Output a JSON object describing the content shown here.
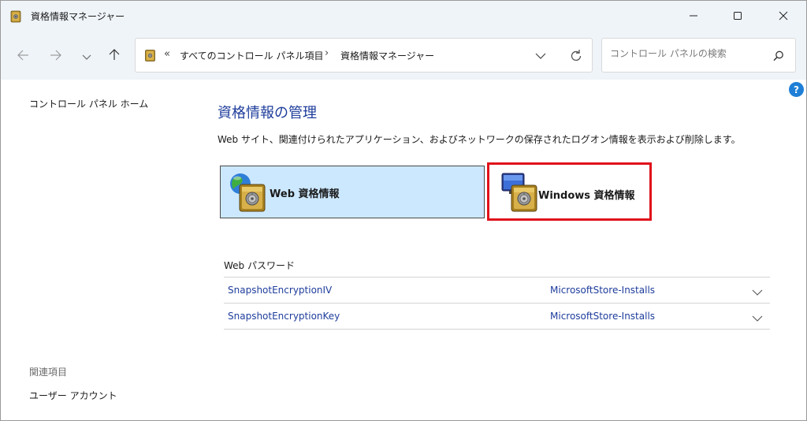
{
  "window": {
    "title": "資格情報マネージャー"
  },
  "titlebar": {
    "icons": [
      "minimize-icon",
      "maximize-icon",
      "close-icon"
    ]
  },
  "nav": {
    "icons": [
      "back-arrow-icon",
      "forward-arrow-icon",
      "recent-chevron-icon",
      "up-arrow-icon"
    ],
    "address_prefix": "«",
    "address_segments": [
      "すべてのコントロール パネル項目",
      "資格情報マネージャー"
    ],
    "address_separator": "›",
    "search_placeholder": "コントロール パネルの検索"
  },
  "help": {
    "label": "?"
  },
  "sidebar": {
    "home": "コントロール パネル ホーム",
    "related_heading": "関連項目",
    "user_accounts": "ユーザー アカウント"
  },
  "main": {
    "heading": "資格情報の管理",
    "description": "Web サイト、関連付けられたアプリケーション、およびネットワークの保存されたログオン情報を表示および削除します。",
    "tiles": [
      {
        "label": "Web 資格情報",
        "icon": "web-credentials-vault-icon",
        "selected": true
      },
      {
        "label": "Windows 資格情報",
        "icon": "windows-credentials-vault-icon",
        "selected": false,
        "highlighted": true
      }
    ],
    "section_label": "Web パスワード",
    "passwords": [
      {
        "resource": "SnapshotEncryptionIV",
        "user": "MicrosoftStore-Installs"
      },
      {
        "resource": "SnapshotEncryptionKey",
        "user": "MicrosoftStore-Installs"
      }
    ]
  },
  "colors": {
    "chrome": "#eff4f9",
    "selected_tile": "#cce8ff",
    "highlight_border": "#e0111b",
    "link": "#1e3d9c",
    "heading": "#1e3d9c",
    "help": "#1f7fd6"
  }
}
